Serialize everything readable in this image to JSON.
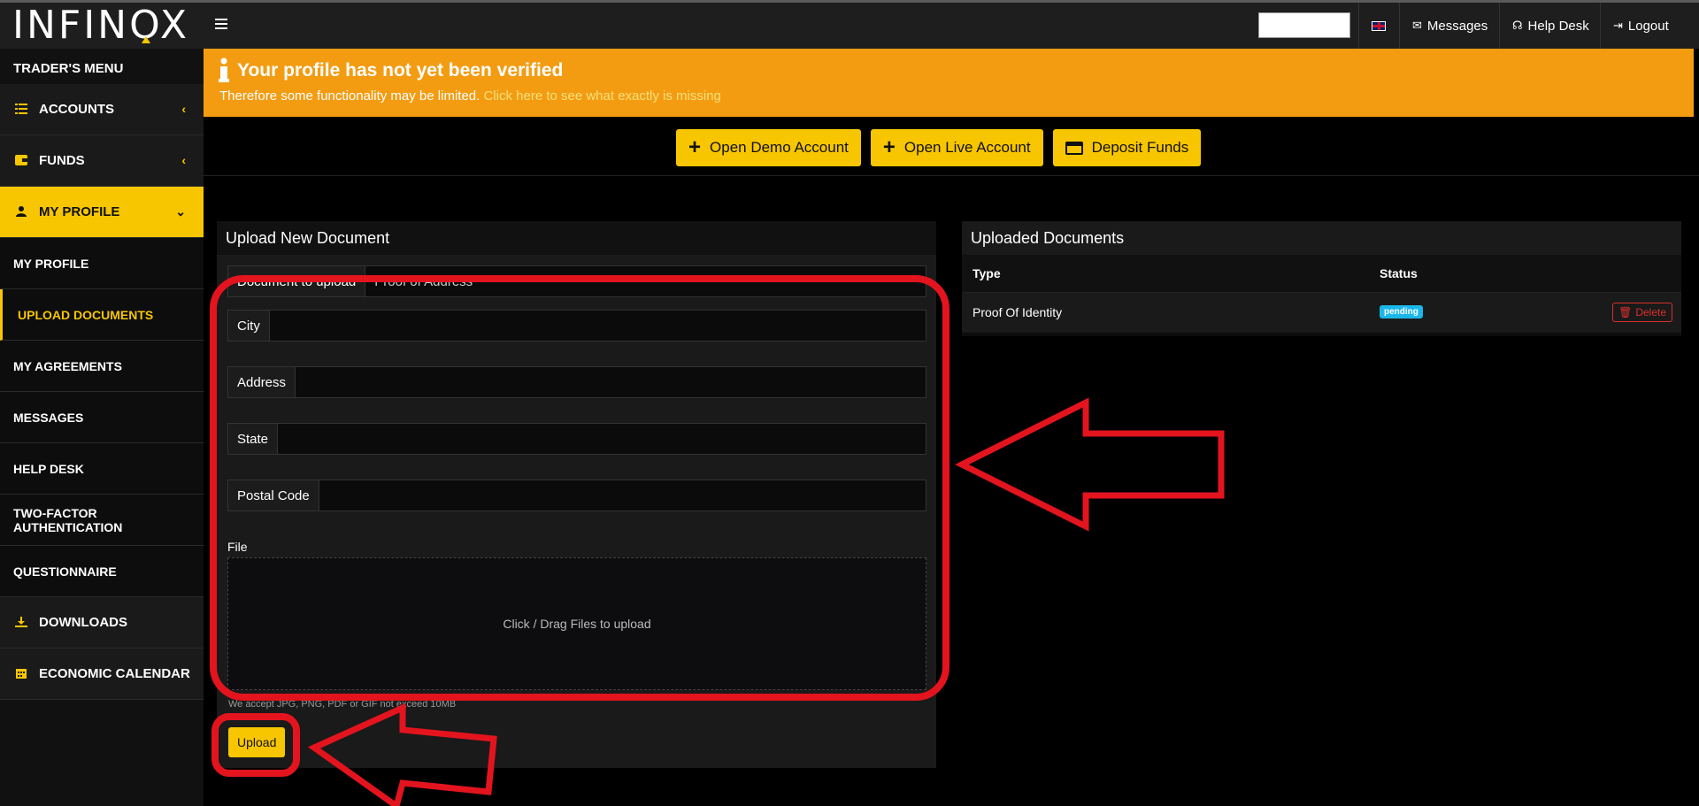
{
  "header": {
    "logo": "INFINOX",
    "messages_label": "Messages",
    "helpdesk_label": "Help Desk",
    "logout_label": "Logout"
  },
  "sidebar": {
    "title": "TRADER'S MENU",
    "items": [
      {
        "label": "ACCOUNTS",
        "icon": "list-icon"
      },
      {
        "label": "FUNDS",
        "icon": "wallet-icon"
      },
      {
        "label": "MY PROFILE",
        "icon": "user-icon"
      },
      {
        "label": "MY PROFILE"
      },
      {
        "label": "UPLOAD DOCUMENTS"
      },
      {
        "label": "MY AGREEMENTS"
      },
      {
        "label": "MESSAGES"
      },
      {
        "label": "HELP DESK"
      },
      {
        "label": "TWO-FACTOR AUTHENTICATION"
      },
      {
        "label": "QUESTIONNAIRE"
      },
      {
        "label": "DOWNLOADS",
        "icon": "download-icon"
      },
      {
        "label": "ECONOMIC CALENDAR",
        "icon": "calendar-icon"
      }
    ]
  },
  "banner": {
    "title": "Your profile has not yet been verified",
    "text": "Therefore some functionality may be limited. ",
    "link": "Click here to see what exactly is missing"
  },
  "actions": {
    "demo": "Open Demo Account",
    "live": "Open Live Account",
    "deposit": "Deposit Funds"
  },
  "upload": {
    "title": "Upload New Document",
    "doc_type_label": "Document to upload",
    "doc_type_value": "Proof of Address",
    "fields": [
      {
        "label": "City",
        "value": ""
      },
      {
        "label": "Address",
        "value": ""
      },
      {
        "label": "State",
        "value": ""
      },
      {
        "label": "Postal Code",
        "value": ""
      }
    ],
    "file_label": "File",
    "dropzone_text": "Click / Drag Files to upload",
    "accept_text": "We accept JPG, PNG, PDF or GIF not exceed 10MB",
    "upload_button": "Upload"
  },
  "uploaded": {
    "title": "Uploaded Documents",
    "columns": [
      "Type",
      "Status"
    ],
    "rows": [
      {
        "type": "Proof Of Identity",
        "status": "pending",
        "action": "Delete"
      }
    ]
  },
  "colors": {
    "accent": "#f7c600",
    "banner": "#f39c12",
    "annotation": "#e3141e",
    "status_pending": "#1ab7ea",
    "danger": "#d9302c"
  }
}
